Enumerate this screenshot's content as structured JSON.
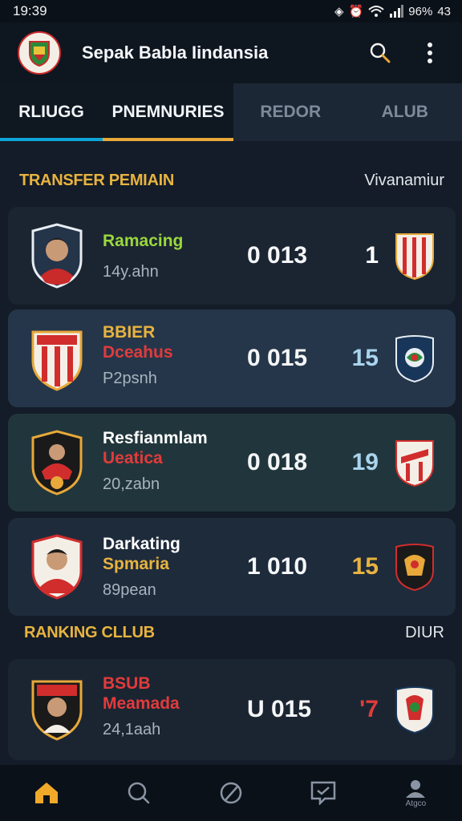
{
  "status_bar": {
    "time": "19:39",
    "battery": "96%",
    "extra": "43"
  },
  "app_bar": {
    "title": "Sepak Babla Iindansia",
    "logo": "club-crest-logo",
    "actions": [
      "search-icon",
      "more-vert-icon"
    ]
  },
  "tabs": [
    {
      "label": "RLIUGG",
      "active": true,
      "indicator": "#0ea5d8"
    },
    {
      "label": "PNEMNURIES",
      "active": true,
      "indicator": "#e8a83a"
    },
    {
      "label": "REDOR",
      "active": false
    },
    {
      "label": "ALUB",
      "active": false
    }
  ],
  "section_transfer": {
    "title": "TRANSFER PEMIAIN",
    "aside": "Vivanamiur"
  },
  "cards": [
    {
      "line1": "Ramacing",
      "line1_color": "#9ad83c",
      "line2": "",
      "line2_color": "#e03a3a",
      "sub": "14y.ahn",
      "score": "0 013",
      "num": "1",
      "num_color": "#ffffff",
      "bg": "#1b2532"
    },
    {
      "line1": "BBIER",
      "line1_color": "#e8b33f",
      "line2": "Dceahus",
      "line2_color": "#e23b3b",
      "sub": "P2psnh",
      "score": "0 015",
      "num": "15",
      "num_color": "#a9d4ee",
      "bg": "#25364a"
    },
    {
      "line1": "Resfianmlam",
      "line1_color": "#ffffff",
      "line2": "Ueatica",
      "line2_color": "#e23b3b",
      "sub": "20,zabn",
      "score": "0 018",
      "num": "19",
      "num_color": "#a9d4ee",
      "bg": "#21363c"
    },
    {
      "line1": "Darkating",
      "line1_color": "#ffffff",
      "line2": "Spmaria",
      "line2_color": "#e8b33f",
      "sub": "89pean",
      "score": "1 010",
      "num": "15",
      "num_color": "#e8b33f",
      "bg": "#1e2b3b"
    }
  ],
  "section_ranking": {
    "title": "RANKING CLLUB",
    "aside": "DIUR"
  },
  "ranking_cards": [
    {
      "line1": "BSUB",
      "line1_color": "#e23b3b",
      "line2": "Meamada",
      "line2_color": "#e23b3b",
      "sub": "24,1aah",
      "score": "U 015",
      "num": "'7",
      "num_color": "#e23b3b",
      "bg": "#1b2532"
    }
  ],
  "bottom_nav": [
    {
      "icon": "home-icon",
      "label": "",
      "active": true
    },
    {
      "icon": "search-icon",
      "label": "",
      "active": false
    },
    {
      "icon": "compass-icon",
      "label": "",
      "active": false
    },
    {
      "icon": "chat-icon",
      "label": "",
      "active": false
    },
    {
      "icon": "profile-icon",
      "label": "Atgco",
      "active": false
    }
  ],
  "colors": {
    "accent": "#e8b33f",
    "background": "#131c28",
    "blue": "#0ea5d8"
  }
}
